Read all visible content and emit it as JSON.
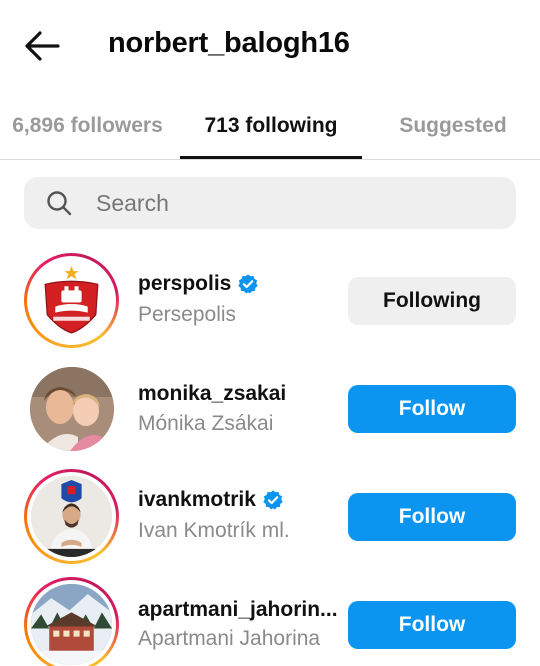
{
  "header": {
    "title": "norbert_balogh16",
    "back_icon": "arrow-left-icon"
  },
  "tabs": [
    {
      "label": "6,896 followers",
      "active": false
    },
    {
      "label": "713 following",
      "active": true
    },
    {
      "label": "Suggested",
      "active": false
    }
  ],
  "search": {
    "placeholder": "Search",
    "value": "",
    "icon": "search-icon"
  },
  "accounts": [
    {
      "username": "perspolis",
      "fullname": "Persepolis",
      "verified": true,
      "button": "Following",
      "has_story_ring": true
    },
    {
      "username": "monika_zsakai",
      "fullname": "Mónika Zsákai",
      "verified": false,
      "button": "Follow",
      "has_story_ring": false
    },
    {
      "username": "ivankmotrik",
      "fullname": "Ivan Kmotrík ml.",
      "verified": true,
      "button": "Follow",
      "has_story_ring": true
    },
    {
      "username": "apartmani_jahorin...",
      "fullname": "Apartmani Jahorina",
      "verified": false,
      "button": "Follow",
      "has_story_ring": true
    }
  ],
  "colors": {
    "follow_button": "#0b95f0",
    "following_button": "#efefef",
    "verified_badge": "#0b95f0",
    "secondary_text": "#8a8a8a"
  }
}
